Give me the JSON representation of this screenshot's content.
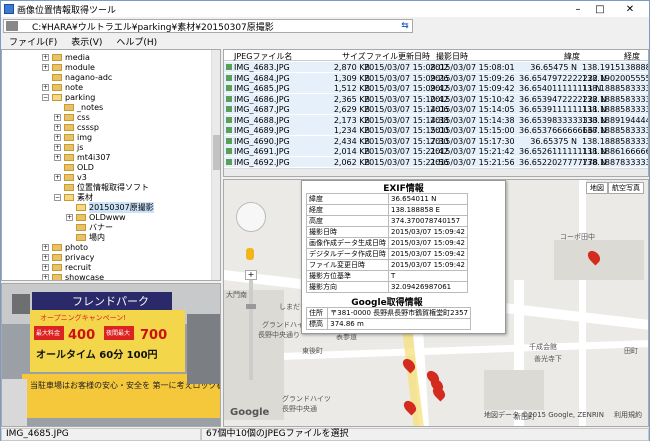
{
  "window": {
    "title": "画像位置情報取得ツール"
  },
  "address": {
    "path": "C:¥HARA¥ウルトラエル¥parking¥素材¥20150307原撮影"
  },
  "menu": [
    "ファイル(F)",
    "表示(V)",
    "ヘルプ(H)"
  ],
  "tree": [
    {
      "label": "media",
      "depth": 1,
      "exp": "+"
    },
    {
      "label": "module",
      "depth": 1,
      "exp": "+"
    },
    {
      "label": "nagano-adc",
      "depth": 1,
      "exp": ""
    },
    {
      "label": "note",
      "depth": 1,
      "exp": "+"
    },
    {
      "label": "parking",
      "depth": 1,
      "exp": "−",
      "open": true
    },
    {
      "label": "_notes",
      "depth": 2,
      "exp": ""
    },
    {
      "label": "css",
      "depth": 2,
      "exp": "+"
    },
    {
      "label": "csssp",
      "depth": 2,
      "exp": "+"
    },
    {
      "label": "img",
      "depth": 2,
      "exp": "+"
    },
    {
      "label": "js",
      "depth": 2,
      "exp": "+"
    },
    {
      "label": "mt4i307",
      "depth": 2,
      "exp": "+"
    },
    {
      "label": "OLD",
      "depth": 2,
      "exp": ""
    },
    {
      "label": "v3",
      "depth": 2,
      "exp": "+"
    },
    {
      "label": "位置情報取得ソフト",
      "depth": 2,
      "exp": ""
    },
    {
      "label": "素材",
      "depth": 2,
      "exp": "−",
      "open": true
    },
    {
      "label": "20150307原撮影",
      "depth": 3,
      "exp": "",
      "selected": true,
      "open": true
    },
    {
      "label": "OLDwww",
      "depth": 3,
      "exp": "+"
    },
    {
      "label": "バナー",
      "depth": 3,
      "exp": ""
    },
    {
      "label": "場内",
      "depth": 3,
      "exp": ""
    },
    {
      "label": "photo",
      "depth": 1,
      "exp": "+"
    },
    {
      "label": "privacy",
      "depth": 1,
      "exp": "+"
    },
    {
      "label": "recruit",
      "depth": 1,
      "exp": "+"
    },
    {
      "label": "showcase",
      "depth": 1,
      "exp": "+"
    }
  ],
  "filelist": {
    "headers": {
      "name": "JPEGファイル名",
      "size": "サイズ",
      "updated": "ファイル更新日時",
      "shot": "撮影日時",
      "lat": "緯度",
      "lon": "経度"
    },
    "rows": [
      {
        "name": "IMG_4683.JPG",
        "size": "2,870 KB",
        "updated": "2015/03/07 15:08:02",
        "shot": "2015/03/07 15:08:01",
        "lat": "36.65475 N",
        "lon": "138.19151388889"
      },
      {
        "name": "IMG_4684.JPG",
        "size": "1,309 KB",
        "updated": "2015/03/07 15:09:26",
        "shot": "2015/03/07 15:09:26",
        "lat": "36.6547972222222 N",
        "lon": "138.19020055556"
      },
      {
        "name": "IMG_4685.JPG",
        "size": "1,512 KB",
        "updated": "2015/03/07 15:09:42",
        "shot": "2015/03/07 15:09:42",
        "lat": "36.654011111111 N",
        "lon": "138.18885833333"
      },
      {
        "name": "IMG_4686.JPG",
        "size": "2,365 KB",
        "updated": "2015/03/07 15:10:42",
        "shot": "2015/03/07 15:10:42",
        "lat": "36.6539472222222 N",
        "lon": "138.18885833333"
      },
      {
        "name": "IMG_4687.JPG",
        "size": "2,629 KB",
        "updated": "2015/03/07 15:14:06",
        "shot": "2015/03/07 15:14:05",
        "lat": "36.6539111111111 N",
        "lon": "138.18885833333"
      },
      {
        "name": "IMG_4688.JPG",
        "size": "2,173 KB",
        "updated": "2015/03/07 15:14:38",
        "shot": "2015/03/07 15:14:38",
        "lat": "36.6539833333333 N",
        "lon": "138.18891944444"
      },
      {
        "name": "IMG_4689.JPG",
        "size": "1,234 KB",
        "updated": "2015/03/07 15:15:00",
        "shot": "2015/03/07 15:15:00",
        "lat": "36.6537666666667 N",
        "lon": "138.18885833333"
      },
      {
        "name": "IMG_4690.JPG",
        "size": "2,434 KB",
        "updated": "2015/03/07 15:17:30",
        "shot": "2015/03/07 15:17:30",
        "lat": "36.65375 N",
        "lon": "138.18885833333"
      },
      {
        "name": "IMG_4691.JPG",
        "size": "2,014 KB",
        "updated": "2015/03/07 15:21:42",
        "shot": "2015/03/07 15:21:42",
        "lat": "36.6526111111111 N",
        "lon": "138.18861666667"
      },
      {
        "name": "IMG_4692.JPG",
        "size": "2,062 KB",
        "updated": "2015/03/07 15:21:56",
        "shot": "2015/03/07 15:21:56",
        "lat": "36.6522027777778 N",
        "lon": "138.18878333333"
      }
    ]
  },
  "map": {
    "mode_buttons": [
      "地図",
      "航空写真"
    ],
    "labels": [
      "コーポ田中",
      "大門南",
      "しまだい",
      "グランドハイツ",
      "長野中央通り",
      "表参道",
      "東後町",
      "千成会館",
      "田町",
      "善光寺下",
      "新田町",
      "グランドハイツ",
      "長野中央通"
    ],
    "attribution": "地図データ ©2015 Google, ZENRIN",
    "terms": "利用規約",
    "google": "Google",
    "popup": {
      "exif_title": "EXIF情報",
      "exif": [
        {
          "k": "緯度",
          "v": "36.654011 N"
        },
        {
          "k": "経度",
          "v": "138.188858 E"
        },
        {
          "k": "高度",
          "v": "374.370078740157"
        },
        {
          "k": "撮影日時",
          "v": "2015/03/07 15:09:42"
        },
        {
          "k": "画像作成データ生成日時",
          "v": "2015/03/07 15:09:42"
        },
        {
          "k": "デジタルデータ作成日時",
          "v": "2015/03/07 15:09:42"
        },
        {
          "k": "ファイル変更日時",
          "v": "2015/03/07 15:09:42"
        },
        {
          "k": "撮影方位基準",
          "v": "T"
        },
        {
          "k": "撮影方向",
          "v": "32.09426987061"
        }
      ],
      "google_title": "Google取得情報",
      "google_info": [
        {
          "k": "住所",
          "v": "〒381-0000 長野県長野市鶴賀権堂町2357"
        },
        {
          "k": "標高",
          "v": "374.86 m"
        }
      ]
    }
  },
  "photo": {
    "sign_title": "フレンドパーク",
    "campaign": "オープニングキャンペーン!",
    "day_label": "最大料金",
    "day_price": "400",
    "night_label": "夜間最大",
    "night_price": "700",
    "all_night": "オールタイム 60分 100円",
    "banner": "当駐車場はお客様の安心・安全を 第一に考えロック板をなくしました"
  },
  "status": {
    "file": "IMG_4685.JPG",
    "message": "67個中10個のJPEGファイルを選択"
  }
}
